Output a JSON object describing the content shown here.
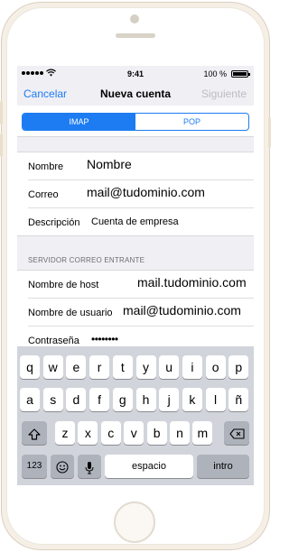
{
  "status_bar": {
    "time": "9:41",
    "battery_percent": "100 %",
    "battery_level": 1.0
  },
  "nav": {
    "cancel_label": "Cancelar",
    "title": "Nueva cuenta",
    "next_label": "Siguiente"
  },
  "segments": {
    "imap_label": "IMAP",
    "pop_label": "POP",
    "selected": "IMAP"
  },
  "account_fields": [
    {
      "label": "Nombre",
      "value": "Nombre"
    },
    {
      "label": "Correo",
      "value": "mail@tudominio.com"
    },
    {
      "label": "Descripción",
      "value": "Cuenta de empresa"
    }
  ],
  "incoming_header": "SERVIDOR CORREO ENTRANTE",
  "incoming_fields": [
    {
      "label": "Nombre de host",
      "value": "mail.tudominio.com"
    },
    {
      "label": "Nombre de usuario",
      "value": "mail@tudominio.com"
    },
    {
      "label": "Contraseña",
      "value": "••••••••"
    }
  ],
  "keyboard": {
    "row1": [
      "q",
      "w",
      "e",
      "r",
      "t",
      "y",
      "u",
      "i",
      "o",
      "p"
    ],
    "row2": [
      "a",
      "s",
      "d",
      "f",
      "g",
      "h",
      "j",
      "k",
      "l",
      "ñ"
    ],
    "row3": [
      "z",
      "x",
      "c",
      "v",
      "b",
      "n",
      "m"
    ],
    "numbers_label": "123",
    "space_label": "espacio",
    "return_label": "intro",
    "icons": [
      "shift-icon",
      "backspace-icon",
      "emoji-icon",
      "microphone-icon"
    ]
  },
  "colors": {
    "accent": "#1d7cf2",
    "disabled": "#bcbcc2",
    "keyboard_bg": "#d1d4db",
    "phone_body": "#f5efe6"
  }
}
